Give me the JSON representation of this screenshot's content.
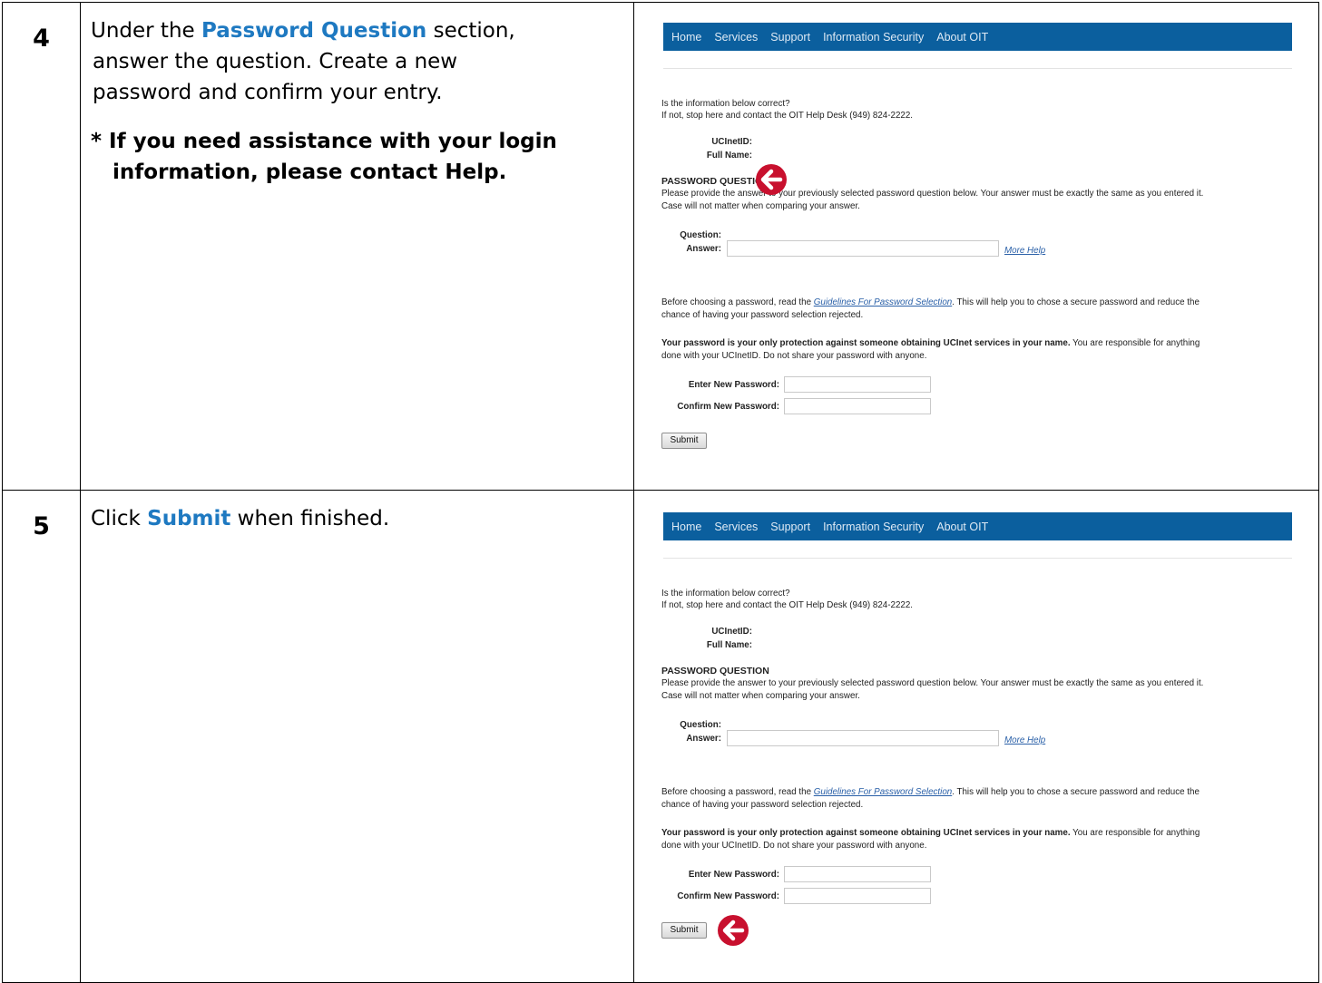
{
  "steps": [
    {
      "number": "4",
      "text_pre": "Under the ",
      "highlight": "Password Question",
      "text_post": " section,",
      "line2": "answer the question. Create a new",
      "line3": "password and confirm your entry.",
      "note_line1": "* If you need assistance with your login",
      "note_line2": "information, please contact Help."
    },
    {
      "number": "5",
      "text_pre": "Click ",
      "highlight": "Submit",
      "text_post": " when finished."
    }
  ],
  "screenshot": {
    "nav": [
      "Home",
      "Services",
      "Support",
      "Information Security",
      "About OIT"
    ],
    "intro_line1": "Is the information below correct?",
    "intro_line2": "If not, stop here and contact the OIT Help Desk (949) 824-2222.",
    "ucinetid_label": "UCInetID:",
    "fullname_label": "Full Name:",
    "section_heading": "PASSWORD QUESTION",
    "section_desc1": "Please provide the answer to your previously selected password question below. Your answer must be exactly the same as you entered it.",
    "section_desc2": "Case will not matter when comparing your answer.",
    "question_label": "Question:",
    "answer_label": "Answer:",
    "more_help": "More Help",
    "guide_pre": "Before choosing a password, read the ",
    "guide_link": "Guidelines For Password Selection",
    "guide_post": ". This will help you to chose a secure password and reduce the",
    "guide_line2": "chance of having your password selection rejected.",
    "warn_bold": "Your password is your only protection against someone obtaining UCInet services in your name.",
    "warn_rest": " You are responsible for anything",
    "warn_line2": "done with your UCInetID. Do not share your password with anyone.",
    "new_pw_label": "Enter New Password:",
    "confirm_pw_label": "Confirm New Password:",
    "submit_label": "Submit",
    "accent": "#0b5f9e",
    "arrow_color": "#c8102e"
  }
}
